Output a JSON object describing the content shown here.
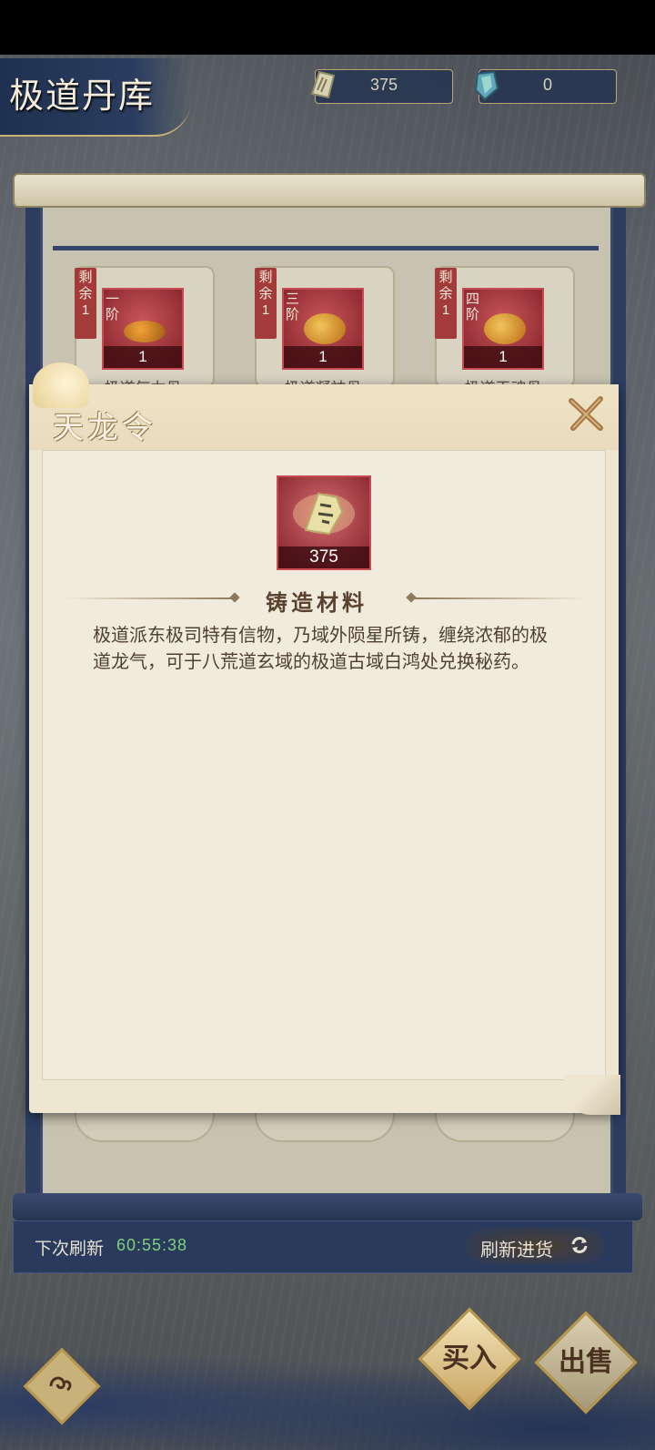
{
  "header": {
    "title": "极道丹库",
    "currency_1": {
      "value": "375",
      "icon": "token-icon"
    },
    "currency_2": {
      "value": "0",
      "icon": "gem-icon"
    }
  },
  "shop": {
    "items": [
      {
        "remaining_label": "剩余",
        "remaining": "1",
        "tier": "一阶",
        "count": "1",
        "name_partial": "极道气力丹"
      },
      {
        "remaining_label": "剩余",
        "remaining": "1",
        "tier": "三阶",
        "count": "1",
        "name_partial": "极道凝神丹"
      },
      {
        "remaining_label": "剩余",
        "remaining": "1",
        "tier": "四阶",
        "count": "1",
        "name_partial": "极道天魂丹"
      }
    ]
  },
  "popup": {
    "title": "天龙令",
    "item_count": "375",
    "category": "铸造材料",
    "description": "极道派东极司特有信物，乃域外陨星所铸，缠绕浓郁的极道龙气，可于八荒道玄域的极道古域白鸿处兑换秘药。"
  },
  "footer": {
    "next_refresh_label": "下次刷新",
    "next_refresh_timer": "60:55:38",
    "refresh_button": "刷新进货",
    "buy_button": "买入",
    "sell_button": "出售"
  },
  "colors": {
    "accent": "#2a3a5c",
    "timer": "#7fd07a",
    "item_bg": "#7d1f25",
    "parchment": "#efe6d2"
  }
}
